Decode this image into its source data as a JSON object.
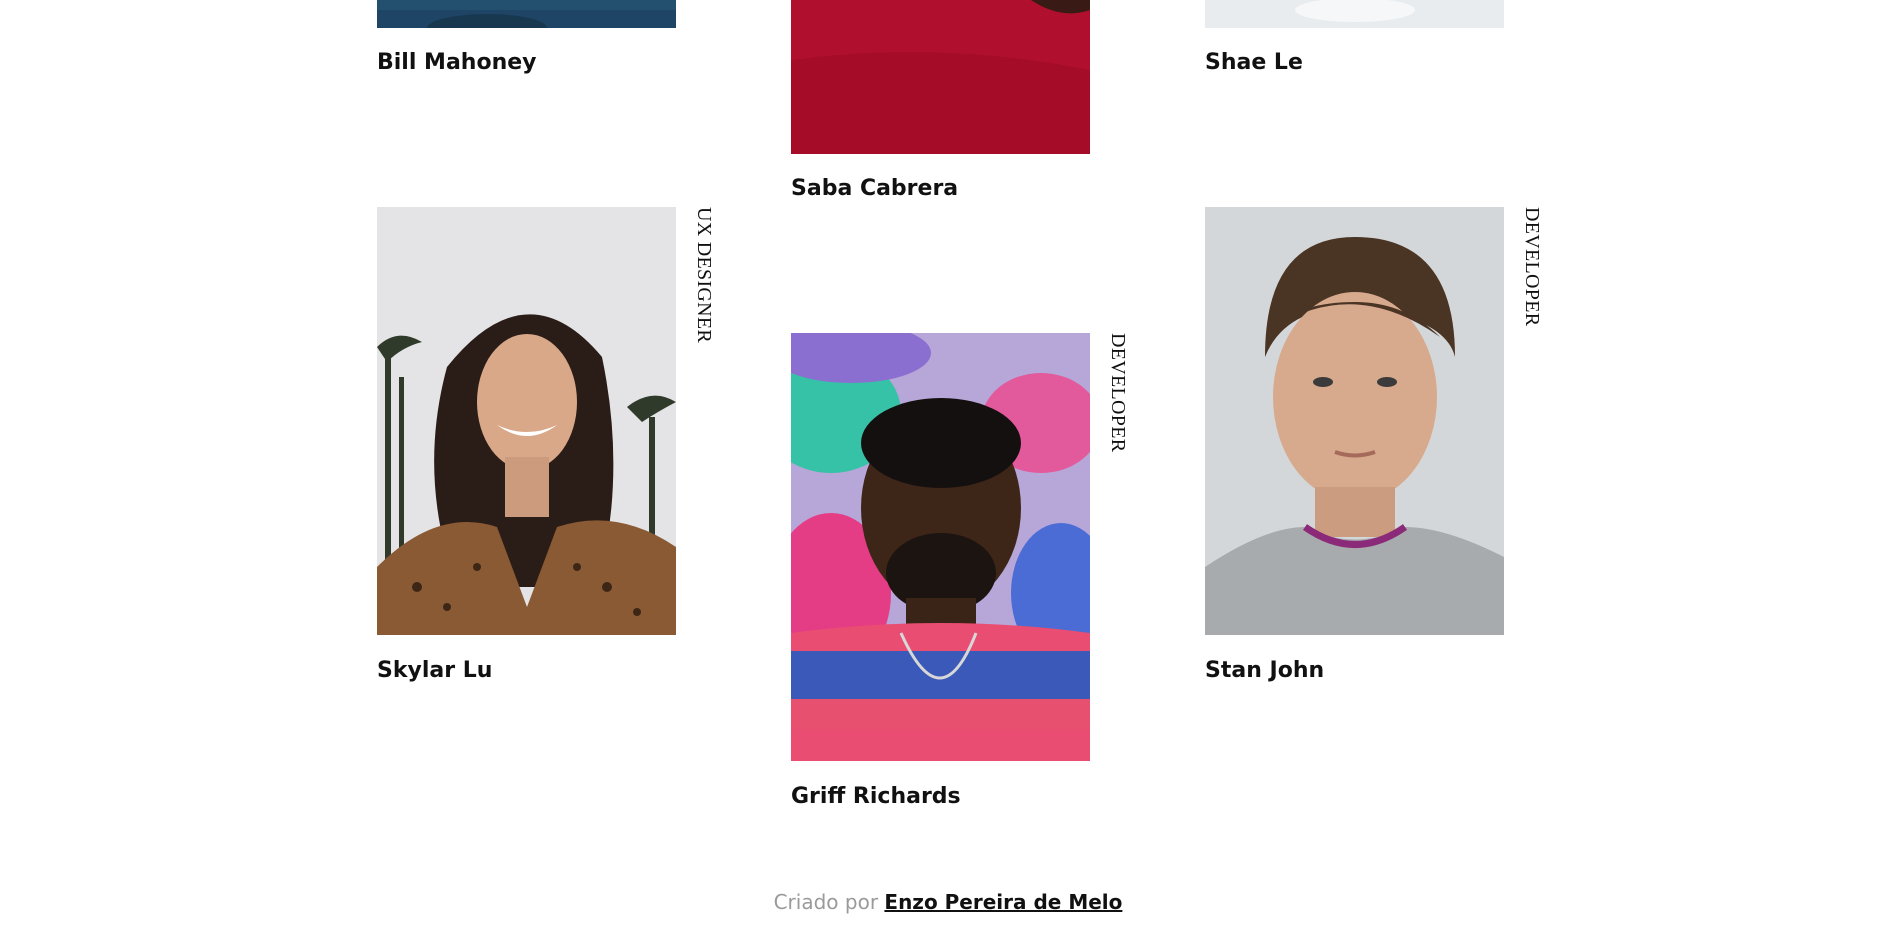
{
  "team": {
    "row1": [
      {
        "name": "Bill Mahoney"
      },
      {
        "name": "Saba Cabrera"
      },
      {
        "name": "Shae Le"
      }
    ],
    "row2": [
      {
        "name": "Skylar Lu",
        "role": "UX DESIGNER"
      },
      {
        "name": "Griff Richards",
        "role": "DEVELOPER"
      },
      {
        "name": "Stan John",
        "role": "DEVELOPER"
      }
    ]
  },
  "footer": {
    "prefix": "Criado por",
    "author_link": "Enzo Pereira de Melo"
  },
  "colors": {
    "text": "#111111",
    "footer_muted": "#9a9a9a",
    "background": "#ffffff"
  }
}
